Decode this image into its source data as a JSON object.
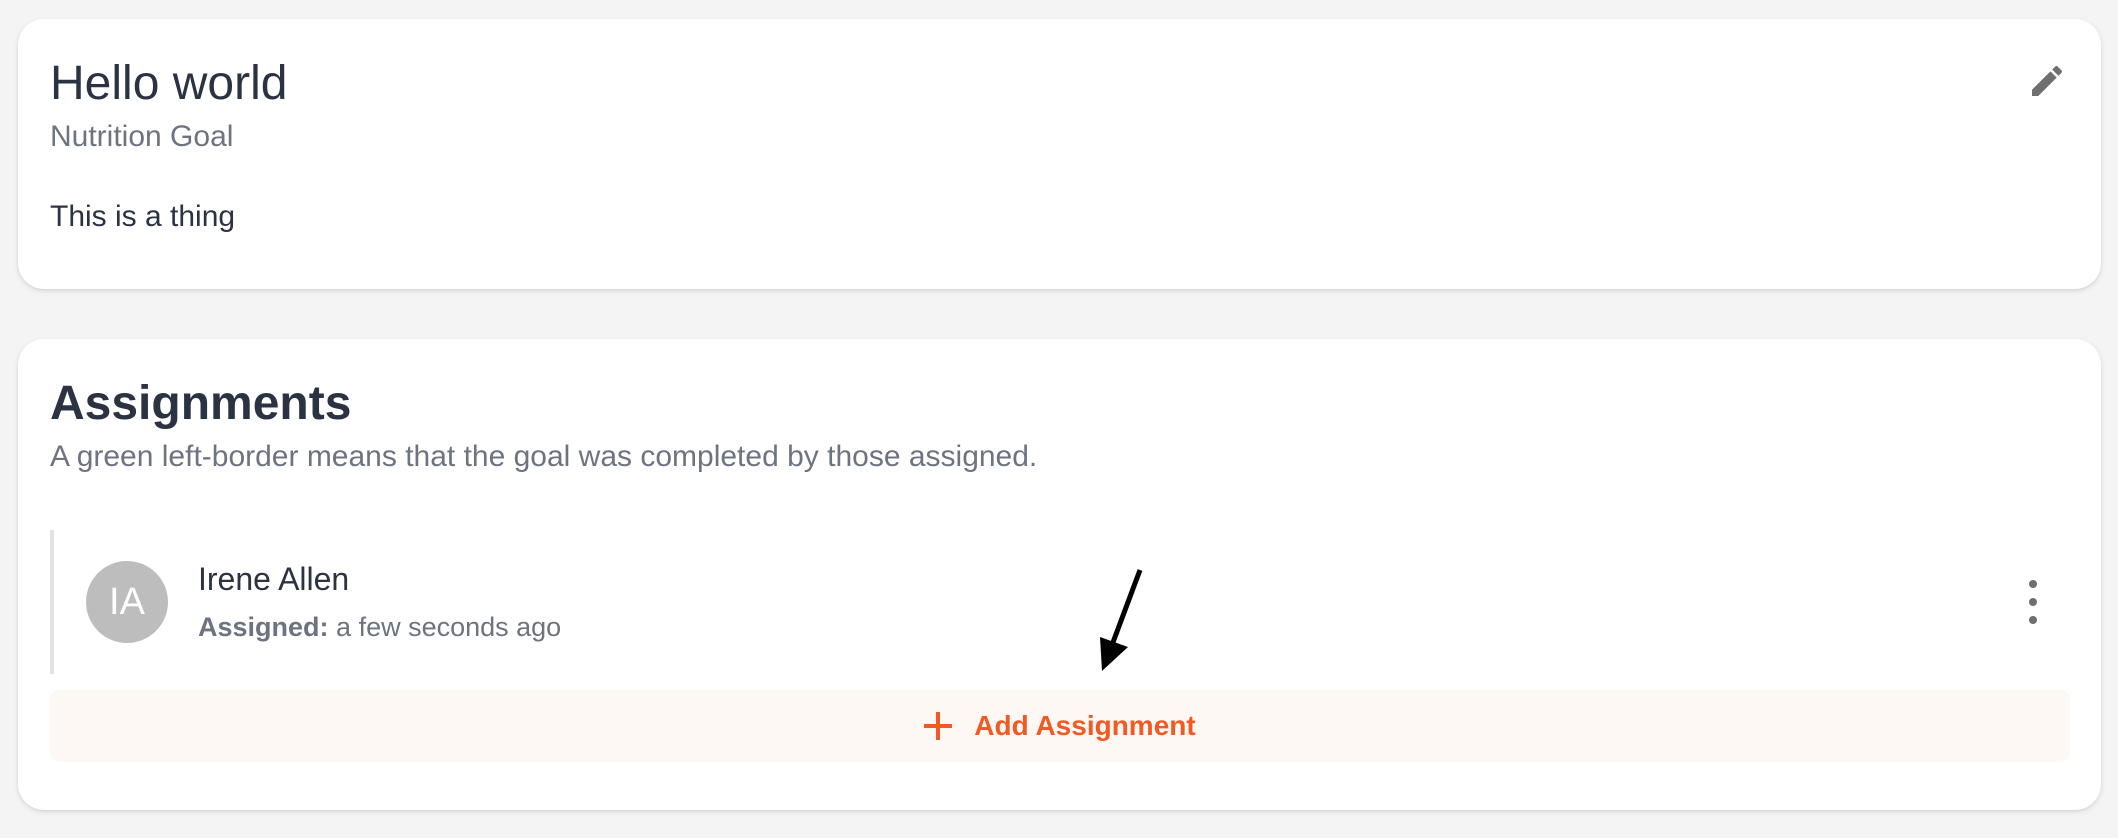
{
  "goal": {
    "title": "Hello world",
    "subtitle": "Nutrition Goal",
    "description": "This is a thing",
    "edit_icon": "pencil-icon"
  },
  "assignments": {
    "title": "Assignments",
    "description": "A green left-border means that the goal was completed by those assigned.",
    "items": [
      {
        "initials": "IA",
        "name": "Irene Allen",
        "assigned_label": "Assigned:",
        "assigned_time": "a few seconds ago",
        "menu_icon": "more-vertical-icon"
      }
    ],
    "add_button_label": "Add Assignment",
    "add_icon": "plus-icon"
  },
  "annotation": {
    "arrow_icon": "arrow-annotation"
  },
  "colors": {
    "accent": "#f15a24",
    "add_button_bg": "#fef8f5",
    "avatar_bg": "#bdbdbd",
    "text_primary": "#2b3343",
    "text_secondary": "#6d7380",
    "page_bg": "#f4f4f4"
  }
}
